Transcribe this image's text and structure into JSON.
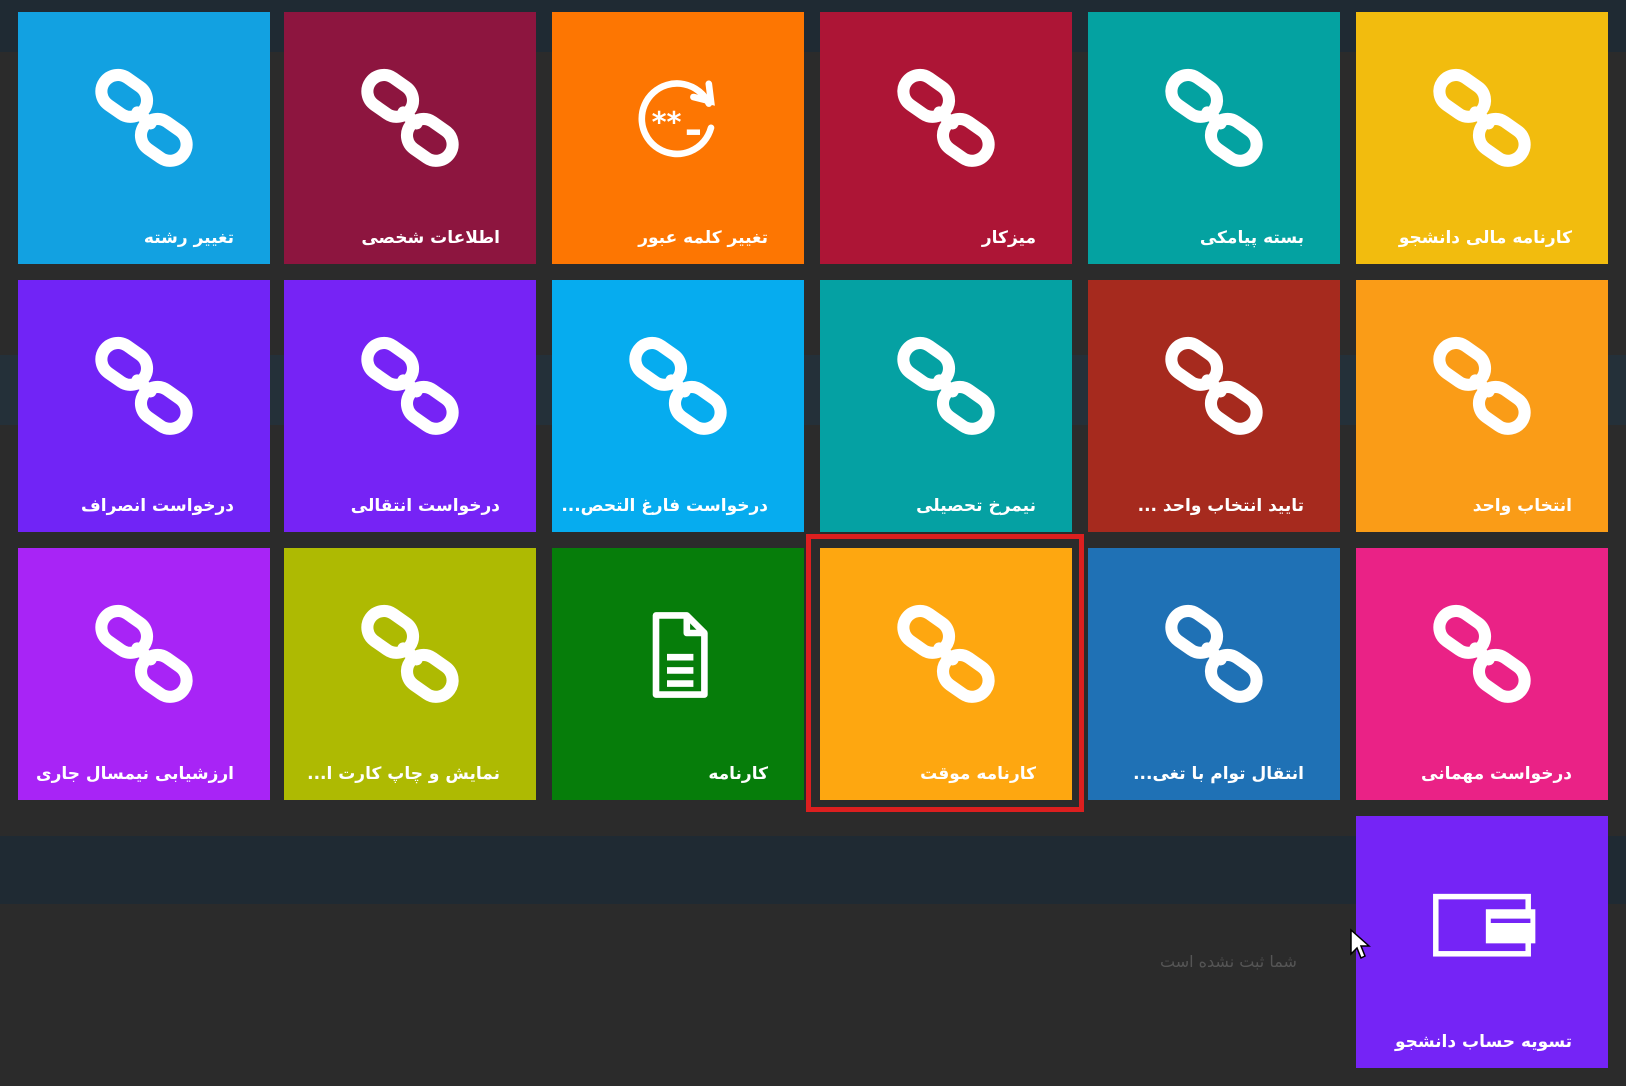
{
  "tiles": [
    {
      "label": "کارنامه مالی دانشجو",
      "icon": "link-icon",
      "color": "#f2bc0e"
    },
    {
      "label": "بسته پیامکی",
      "icon": "link-icon",
      "color": "#04a2a1"
    },
    {
      "label": "میزکار",
      "icon": "link-icon",
      "color": "#ad1536"
    },
    {
      "label": "تغییر کلمه عبور",
      "icon": "password-reset-icon",
      "color": "#fd7602"
    },
    {
      "label": "اطلاعات شخصی",
      "icon": "link-icon",
      "color": "#8d153f"
    },
    {
      "label": "تغییر رشته",
      "icon": "link-icon",
      "color": "#12a1e1"
    },
    {
      "label": "انتخاب واحد",
      "icon": "link-icon",
      "color": "#fa9c17"
    },
    {
      "label": "تایید انتخاب واحد ...",
      "icon": "link-icon",
      "color": "#a62a1e"
    },
    {
      "label": "نیمرخ تحصیلی",
      "icon": "link-icon",
      "color": "#05a1a3"
    },
    {
      "label": "درخواست فارغ التحص...",
      "icon": "link-icon",
      "color": "#06acef"
    },
    {
      "label": "درخواست انتقالی",
      "icon": "link-icon",
      "color": "#7623f5"
    },
    {
      "label": "درخواست انصراف",
      "icon": "link-icon",
      "color": "#7124f6"
    },
    {
      "label": "درخواست مهمانی",
      "icon": "link-icon",
      "color": "#ea2286"
    },
    {
      "label": "انتقال توام با تغی...",
      "icon": "link-icon",
      "color": "#1f71b5"
    },
    {
      "label": "کارنامه موقت",
      "icon": "link-icon",
      "color": "#fea710"
    },
    {
      "label": "کارنامه",
      "icon": "document-icon",
      "color": "#067d0a"
    },
    {
      "label": "نمایش و چاپ کارت ا...",
      "icon": "link-icon",
      "color": "#aeba02"
    },
    {
      "label": "ارزشیابی نیمسال جاری",
      "icon": "link-icon",
      "color": "#a824f6"
    },
    {
      "label": "تسویه حساب دانشجو",
      "icon": "payment-card-icon",
      "color": "#7524f6"
    }
  ],
  "background": {
    "status_text": "شما ثبت نشده است"
  },
  "highlight_color": "#dc1f1f"
}
